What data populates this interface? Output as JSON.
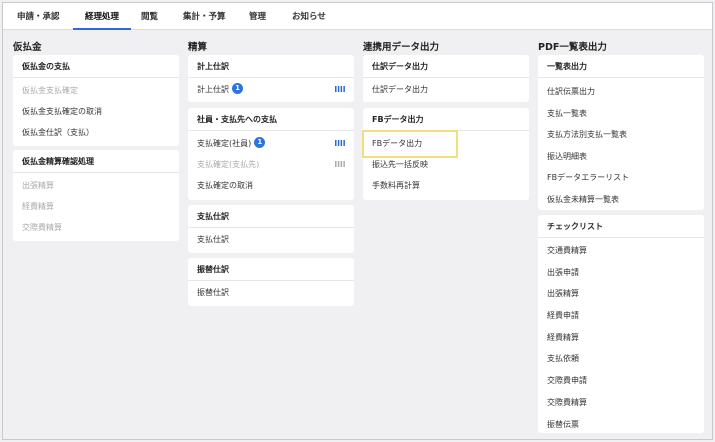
{
  "nav": {
    "tabs": [
      {
        "label": "申請・承認"
      },
      {
        "label": "経理処理"
      },
      {
        "label": "閲覧"
      },
      {
        "label": "集計・予算"
      },
      {
        "label": "管理"
      },
      {
        "label": "お知らせ"
      }
    ],
    "active_index": 1
  },
  "colors": {
    "accent": "#2a6ad4",
    "badge": "#2f74d8",
    "highlight": "#f3dd7f",
    "background": "#f0f0f2",
    "disabled_text": "#aaaaaa"
  },
  "columns": [
    {
      "title": "仮払金",
      "cards": [
        {
          "title": "仮払金の支払",
          "items": [
            {
              "label": "仮払金支払確定",
              "disabled": true
            },
            {
              "label": "仮払金支払確定の取消"
            },
            {
              "label": "仮払金仕訳（支払）"
            }
          ]
        },
        {
          "title": "仮払金精算確認処理",
          "items": [
            {
              "label": "出張精算",
              "disabled": true
            },
            {
              "label": "経費精算",
              "disabled": true
            },
            {
              "label": "交際費精算",
              "disabled": true
            }
          ]
        }
      ]
    },
    {
      "title": "精算",
      "cards": [
        {
          "title": "計上仕訳",
          "items": [
            {
              "label": "計上仕訳",
              "badge": "1",
              "icon": "bars-icon"
            }
          ]
        },
        {
          "title": "社員・支払先への支払",
          "items": [
            {
              "label": "支払確定(社員)",
              "badge": "1",
              "icon": "bars-icon"
            },
            {
              "label": "支払確定(支払先)",
              "disabled": true,
              "icon": "bars-icon"
            },
            {
              "label": "支払確定の取消"
            }
          ]
        },
        {
          "title": "支払仕訳",
          "items": [
            {
              "label": "支払仕訳"
            }
          ]
        },
        {
          "title": "振替仕訳",
          "items": [
            {
              "label": "振替仕訳"
            }
          ]
        }
      ]
    },
    {
      "title": "連携用データ出力",
      "cards": [
        {
          "title": "仕訳データ出力",
          "items": [
            {
              "label": "仕訳データ出力"
            }
          ]
        },
        {
          "title": "FBデータ出力",
          "items": [
            {
              "label": "FBデータ出力"
            },
            {
              "label": "振込先一括反映"
            },
            {
              "label": "手数料再計算"
            }
          ]
        }
      ]
    },
    {
      "title": "PDF一覧表出力",
      "cards": [
        {
          "title": "一覧表出力",
          "items": [
            {
              "label": "仕訳伝票出力"
            },
            {
              "label": "支払一覧表"
            },
            {
              "label": "支払方法別支払一覧表"
            },
            {
              "label": "振込明細表"
            },
            {
              "label": "FBデータエラーリスト"
            },
            {
              "label": "仮払金未精算一覧表"
            }
          ]
        },
        {
          "title": "チェックリスト",
          "items": [
            {
              "label": "交通費精算"
            },
            {
              "label": "出張申請"
            },
            {
              "label": "出張精算"
            },
            {
              "label": "経費申請"
            },
            {
              "label": "経費精算"
            },
            {
              "label": "支払依頼"
            },
            {
              "label": "交際費申請"
            },
            {
              "label": "交際費精算"
            },
            {
              "label": "振替伝票"
            }
          ]
        }
      ]
    }
  ]
}
